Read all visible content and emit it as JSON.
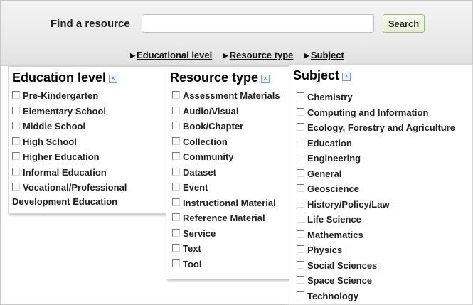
{
  "search": {
    "label": "Find a resource",
    "input_value": "",
    "button_label": "Search"
  },
  "filter_links": [
    {
      "label": "Educational level"
    },
    {
      "label": "Resource type"
    },
    {
      "label": "Subject"
    }
  ],
  "panels": {
    "education": {
      "title": "Education level",
      "items": [
        "Pre-Kindergarten",
        "Elementary School",
        "Middle School",
        "High School",
        "Higher Education",
        "Informal Education",
        "Vocational/Professional Development Education"
      ]
    },
    "resource": {
      "title": "Resource type",
      "items": [
        "Assessment Materials",
        "Audio/Visual",
        "Book/Chapter",
        "Collection",
        "Community",
        "Dataset",
        "Event",
        "Instructional Material",
        "Reference Material",
        "Service",
        "Text",
        "Tool"
      ]
    },
    "subject": {
      "title": "Subject",
      "items": [
        "Chemistry",
        "Computing and Information",
        "Ecology, Forestry and Agriculture",
        "Education",
        "Engineering",
        "General",
        "Geoscience",
        "History/Policy/Law",
        "Life Science",
        "Mathematics",
        "Physics",
        "Social Sciences",
        "Space Science",
        "Technology"
      ]
    }
  },
  "icons": {
    "close": "close-icon",
    "checkbox": "checkbox-icon",
    "triangle": "triangle-right-icon"
  },
  "colors": {
    "close_icon_border": "#7a9cd3",
    "search_button_border": "#9dbb82"
  }
}
